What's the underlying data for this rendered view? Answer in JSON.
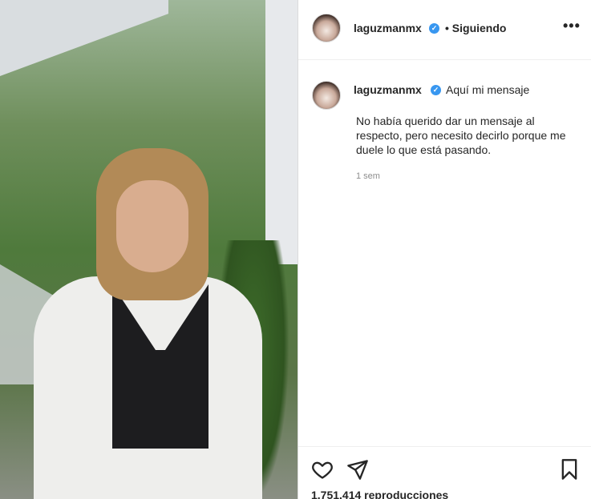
{
  "post": {
    "username": "laguzmanmx",
    "follow_status": "• Siguiendo",
    "more_label": "•••"
  },
  "comment": {
    "username": "laguzmanmx",
    "title": "Aquí mi mensaje",
    "body": "No había querido dar un mensaje al respecto, pero necesito decirlo porque me duele lo que está pasando.",
    "time": "1 sem"
  },
  "actions": {
    "views": "1.751.414 reproducciones"
  },
  "icons": {
    "verified": "verified-badge-icon",
    "like": "heart-icon",
    "share": "send-icon",
    "save": "bookmark-icon"
  },
  "colors": {
    "verified": "#3897f0",
    "text": "#262626",
    "muted": "#8e8e8e"
  }
}
